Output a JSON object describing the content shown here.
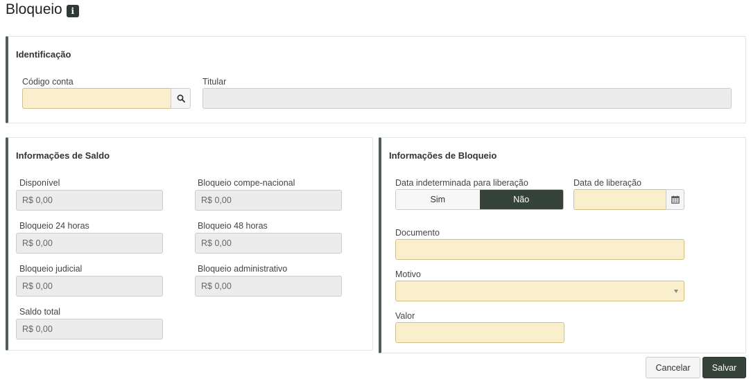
{
  "page": {
    "title": "Bloqueio",
    "info_icon": "i"
  },
  "identificacao": {
    "title": "Identificação",
    "codigo_label": "Código conta",
    "codigo_value": "",
    "titular_label": "Titular",
    "titular_value": ""
  },
  "saldo": {
    "title": "Informações de Saldo",
    "fields": [
      {
        "label": "Disponível",
        "value": "R$ 0,00"
      },
      {
        "label": "Bloqueio compe-nacional",
        "value": "R$ 0,00"
      },
      {
        "label": "Bloqueio 24 horas",
        "value": "R$ 0,00"
      },
      {
        "label": "Bloqueio 48 horas",
        "value": "R$ 0,00"
      },
      {
        "label": "Bloqueio judicial",
        "value": "R$ 0,00"
      },
      {
        "label": "Bloqueio administrativo",
        "value": "R$ 0,00"
      },
      {
        "label": "Saldo total",
        "value": "R$ 0,00"
      }
    ]
  },
  "bloqueio": {
    "title": "Informações de Bloqueio",
    "indeterminada_label": "Data indeterminada para liberação",
    "toggle_sim": "Sim",
    "toggle_nao": "Não",
    "toggle_selected": "Não",
    "data_label": "Data de liberação",
    "data_value": "",
    "documento_label": "Documento",
    "documento_value": "",
    "motivo_label": "Motivo",
    "motivo_value": "",
    "valor_label": "Valor",
    "valor_value": ""
  },
  "actions": {
    "cancel": "Cancelar",
    "save": "Salvar"
  },
  "colors": {
    "required_bg": "#f9efcc",
    "readonly_bg": "#ececec",
    "accent_dark": "#36433b"
  }
}
